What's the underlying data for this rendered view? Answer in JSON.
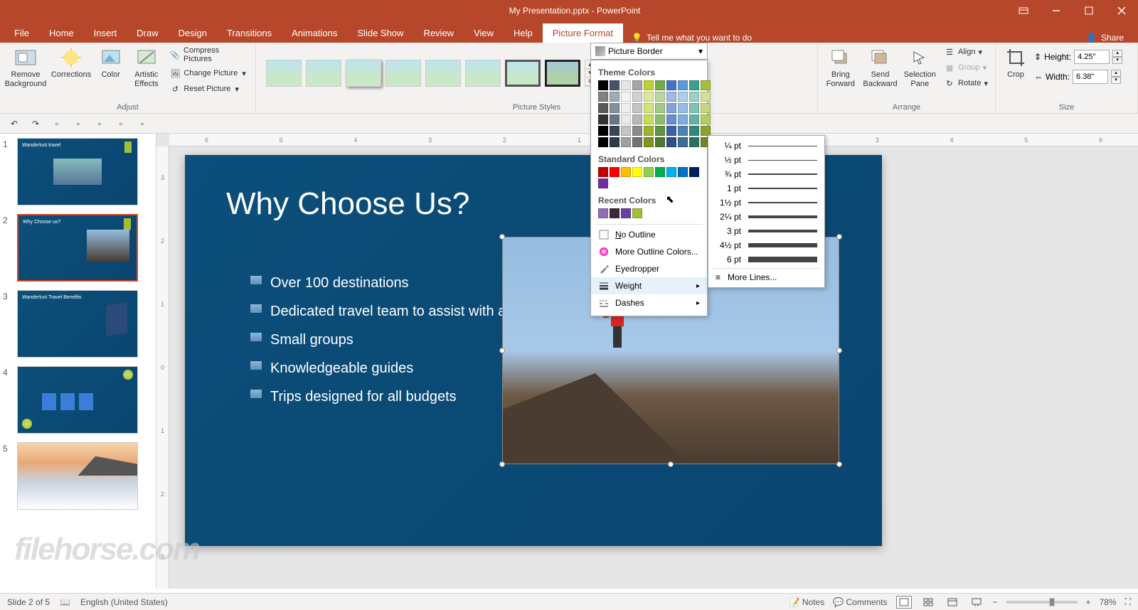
{
  "titlebar": {
    "title": "My Presentation.pptx - PowerPoint"
  },
  "tabs": {
    "file": "File",
    "home": "Home",
    "insert": "Insert",
    "draw": "Draw",
    "design": "Design",
    "transitions": "Transitions",
    "animations": "Animations",
    "slideshow": "Slide Show",
    "review": "Review",
    "view": "View",
    "help": "Help",
    "picture_format": "Picture Format"
  },
  "tell_me": "Tell me what you want to do",
  "share": "Share",
  "ribbon": {
    "adjust": {
      "remove_bg": "Remove Background",
      "corrections": "Corrections",
      "color": "Color",
      "artistic": "Artistic Effects",
      "compress": "Compress Pictures",
      "change": "Change Picture",
      "reset": "Reset Picture",
      "label": "Adjust"
    },
    "styles": {
      "label": "Picture Styles"
    },
    "arrange": {
      "bring_forward": "Bring Forward",
      "send_backward": "Send Backward",
      "selection_pane": "Selection Pane",
      "align": "Align",
      "group": "Group",
      "rotate": "Rotate",
      "label": "Arrange"
    },
    "size": {
      "crop": "Crop",
      "height_label": "Height:",
      "height_value": "4.25\"",
      "width_label": "Width:",
      "width_value": "6.38\"",
      "label": "Size"
    }
  },
  "border_menu": {
    "button": "Picture Border",
    "theme_colors": "Theme Colors",
    "standard_colors": "Standard Colors",
    "recent_colors": "Recent Colors",
    "no_outline": "No Outline",
    "more_colors": "More Outline Colors...",
    "eyedropper": "Eyedropper",
    "weight": "Weight",
    "dashes": "Dashes",
    "theme_swatches_row1": [
      "#000000",
      "#44546a",
      "#e7e6e6",
      "#a5a5a5",
      "#bdd230",
      "#70ad47",
      "#4472c4",
      "#5b9bd5",
      "#3aa18e",
      "#a5c037"
    ],
    "standard_swatches": [
      "#c00000",
      "#ff0000",
      "#ffc000",
      "#ffff00",
      "#92d050",
      "#00b050",
      "#00b0f0",
      "#0070c0",
      "#002060",
      "#7030a0"
    ],
    "recent_swatches": [
      "#8e6fb5",
      "#3b2c3d",
      "#6b3fa0",
      "#a2c037"
    ]
  },
  "weight_menu": {
    "items": [
      {
        "label": "¼ pt",
        "px": 0.5
      },
      {
        "label": "½ pt",
        "px": 1
      },
      {
        "label": "¾ pt",
        "px": 1.5
      },
      {
        "label": "1 pt",
        "px": 2
      },
      {
        "label": "1½ pt",
        "px": 2.5
      },
      {
        "label": "2¼ pt",
        "px": 3.5
      },
      {
        "label": "3 pt",
        "px": 4.5
      },
      {
        "label": "4½ pt",
        "px": 6
      },
      {
        "label": "6 pt",
        "px": 8
      }
    ],
    "more_lines": "More Lines..."
  },
  "slide": {
    "title": "Why Choose Us?",
    "bullets": [
      "Over 100 destinations",
      "Dedicated travel team to assist with all your needs",
      "Small groups",
      "Knowledgeable guides",
      "Trips designed for all budgets"
    ]
  },
  "thumbnails": [
    {
      "title": "Wanderlust travel"
    },
    {
      "title": "Why Choose us?"
    },
    {
      "title": "Wanderlust Travel Benefits"
    },
    {
      "title": ""
    },
    {
      "title": ""
    }
  ],
  "ruler_marks": [
    "6",
    "5",
    "4",
    "3",
    "2",
    "1",
    "0",
    "1",
    "2",
    "3",
    "4",
    "5",
    "6"
  ],
  "vruler_marks": [
    "3",
    "2",
    "1",
    "0",
    "1",
    "2",
    "3"
  ],
  "status": {
    "slide_info": "Slide 2 of 5",
    "language": "English (United States)",
    "notes": "Notes",
    "comments": "Comments",
    "zoom": "78%"
  },
  "watermark": "filehorse.com"
}
